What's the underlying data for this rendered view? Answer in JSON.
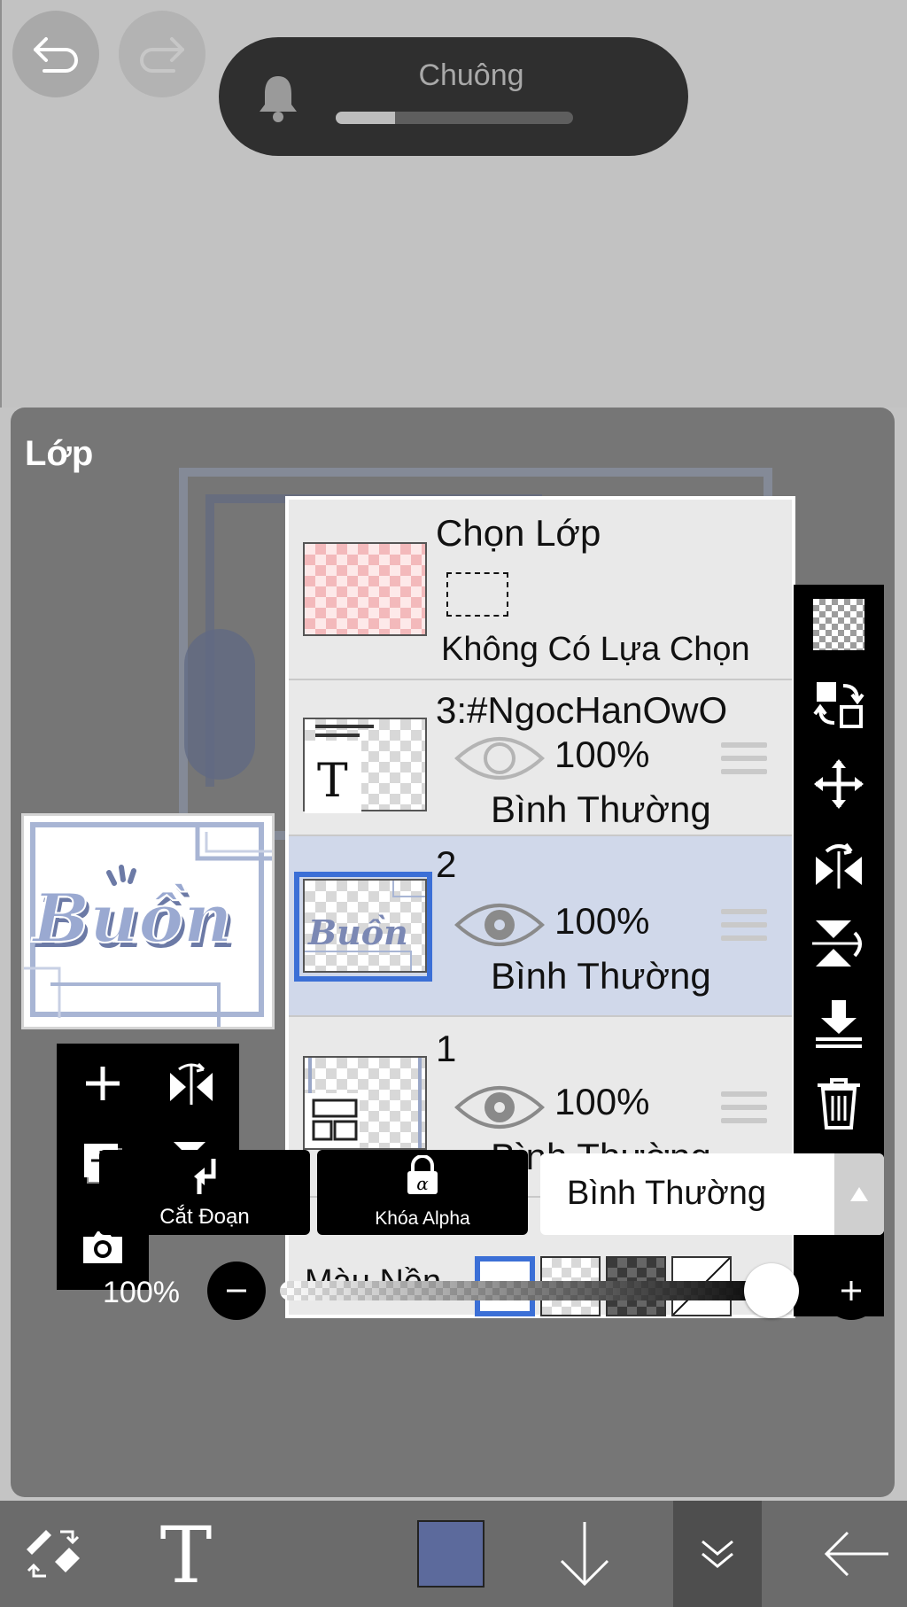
{
  "notification": {
    "title": "Chuông",
    "level": 0.25
  },
  "panel": {
    "title": "Lớp"
  },
  "layers": [
    {
      "id": "selection",
      "name": "Chọn Lớp",
      "sub": "Không Có Lựa Chọn"
    },
    {
      "id": "3",
      "name": "3:#NgocHanOwO",
      "opacity": "100%",
      "blend": "Bình Thường",
      "visible": true,
      "selected": false
    },
    {
      "id": "2",
      "name": "2",
      "opacity": "100%",
      "blend": "Bình Thường",
      "visible": true,
      "selected": true
    },
    {
      "id": "1",
      "name": "1",
      "opacity": "100%",
      "blend": "Bình Thường",
      "visible": true,
      "selected": false
    }
  ],
  "background": {
    "label": "Màu Nền",
    "selected": "white"
  },
  "buttons": {
    "clipping": "Cắt Đoạn",
    "alpha_lock": "Khóa Alpha"
  },
  "blend_mode": "Bình Thường",
  "opacity": {
    "value": "100%",
    "level": 1.0
  },
  "colors": {
    "selected_layer": "#d0d8ea",
    "accent": "#3b6fd6",
    "current_color": "#5c6a9c",
    "art": "#8d9dc6"
  },
  "preview_text": "Buồn"
}
